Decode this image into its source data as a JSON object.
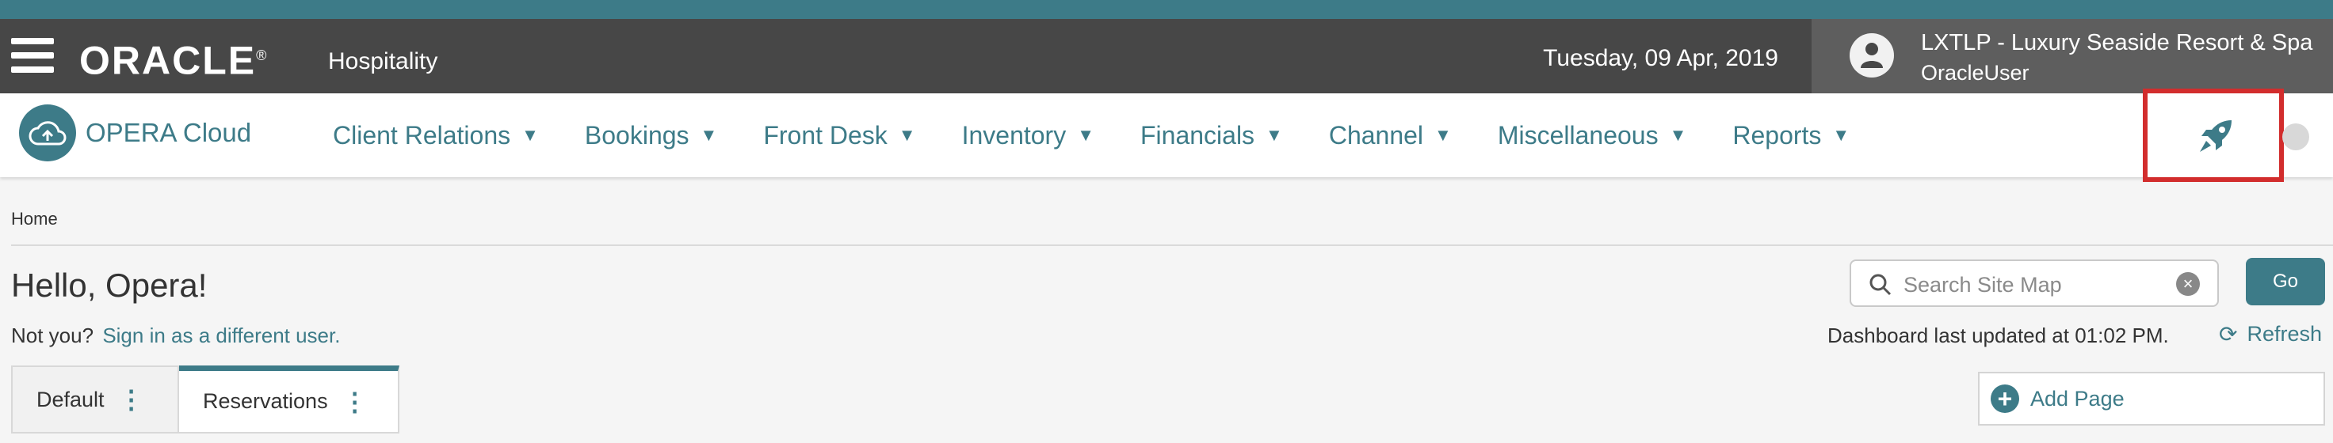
{
  "header": {
    "brand": "ORACLE",
    "brand_mark": "®",
    "product": "Hospitality",
    "date": "Tuesday, 09 Apr, 2019",
    "property": "LXTLP - Luxury Seaside Resort & Spa",
    "user": "OracleUser"
  },
  "nav": {
    "app_name": "OPERA Cloud",
    "items": [
      {
        "label": "Client Relations"
      },
      {
        "label": "Bookings"
      },
      {
        "label": "Front Desk"
      },
      {
        "label": "Inventory"
      },
      {
        "label": "Financials"
      },
      {
        "label": "Channel"
      },
      {
        "label": "Miscellaneous"
      },
      {
        "label": "Reports"
      }
    ]
  },
  "page": {
    "breadcrumb": "Home",
    "greeting": "Hello, Opera!",
    "not_you": "Not you?",
    "sign_in_link": "Sign in as a different user.",
    "search_placeholder": "Search Site Map",
    "go_label": "Go",
    "dashboard_updated": "Dashboard last updated at 01:02 PM.",
    "refresh_label": "Refresh",
    "add_page_label": "Add Page",
    "tabs": [
      {
        "label": "Default"
      },
      {
        "label": "Reservations"
      }
    ]
  },
  "icons": {
    "menu": "hamburger-icon",
    "user": "user-icon",
    "cloud": "cloud-icon",
    "launcher": "rocket-icon",
    "search": "search-icon",
    "clear": "clear-icon",
    "refresh": "refresh-icon",
    "add": "plus-circle-icon",
    "kebab": "kebab-icon"
  },
  "colors": {
    "accent": "#3d7b88",
    "header_bg": "#474747",
    "highlight_border": "#d22d2d"
  }
}
